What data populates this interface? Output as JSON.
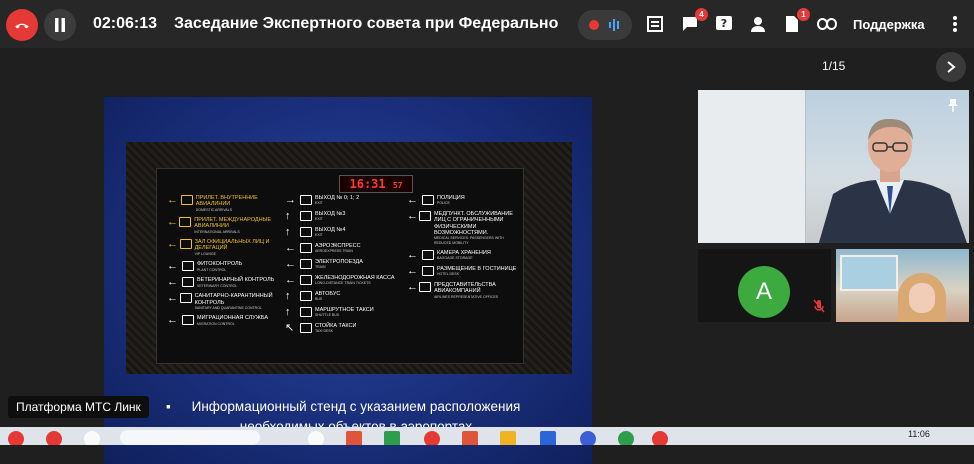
{
  "header": {
    "timer": "02:06:13",
    "title": "Заседание Экспертного совета при Федеральном р",
    "support_label": "Поддержка",
    "chat_badge": "4",
    "docs_badge": "1"
  },
  "presentation": {
    "page_counter": "1/15",
    "clock": "16:31",
    "clock_seconds": "57",
    "caption": "Информационный стенд с указанием расположения необходимых объектов в аэропортах",
    "signs_left": [
      {
        "text": "ПРИЛЕТ. ВНУТРЕННИЕ АВИАЛИНИИ",
        "sub": "DOMESTIC ARRIVALS",
        "arrow": "←"
      },
      {
        "text": "ПРИЛЕТ. МЕЖДУНАРОДНЫЕ АВИАЛИНИИ",
        "sub": "INTERNATIONAL ARRIVALS",
        "arrow": "←"
      },
      {
        "text": "ЗАЛ ОФИЦИАЛЬНЫХ ЛИЦ И ДЕЛЕГАЦИЙ",
        "sub": "VIP LOUNGE",
        "arrow": "←"
      },
      {
        "text": "ФИТОКОНТРОЛЬ",
        "sub": "PLANT CONTROL",
        "arrow": "←"
      },
      {
        "text": "ВЕТЕРИНАРНЫЙ КОНТРОЛЬ",
        "sub": "VETERINARY CONTROL",
        "arrow": "←"
      },
      {
        "text": "САНИТАРНО-КАРАНТИННЫЙ КОНТРОЛЬ",
        "sub": "SANITARY AND QUARANTINE CONTROL",
        "arrow": "←"
      },
      {
        "text": "МИГРАЦИОННАЯ СЛУЖБА",
        "sub": "MIGRATION CONTROL",
        "arrow": "←"
      }
    ],
    "signs_mid": [
      {
        "text": "ВЫХОД № 0; 1; 2",
        "sub": "EXIT",
        "arrow": "→"
      },
      {
        "text": "ВЫХОД №3",
        "sub": "EXIT",
        "arrow": "↑"
      },
      {
        "text": "ВЫХОД №4",
        "sub": "EXIT",
        "arrow": "↑"
      },
      {
        "text": "АЭРОЭКСПРЕСС",
        "sub": "AEROEXPRESS TRAIN",
        "arrow": "←"
      },
      {
        "text": "ЭЛЕКТРОПОЕЗДА",
        "sub": "TRAIN",
        "arrow": "←"
      },
      {
        "text": "ЖЕЛЕЗНОДОРОЖНАЯ КАССА",
        "sub": "LONG-DISTANCE TRAIN TICKETS",
        "arrow": "←"
      },
      {
        "text": "АВТОБУС",
        "sub": "BUS",
        "arrow": "↑"
      },
      {
        "text": "МАРШРУТНОЕ ТАКСИ",
        "sub": "SHUTTLE BUS",
        "arrow": "↑"
      },
      {
        "text": "СТОЙКА ТАКСИ",
        "sub": "TAXI DESK",
        "arrow": "↖"
      }
    ],
    "signs_right": [
      {
        "text": "ПОЛИЦИЯ",
        "sub": "POLICE",
        "arrow": "←"
      },
      {
        "text": "МЕДПУНКТ. ОБСЛУЖИВАНИЕ ЛИЦ С ОГРАНИЧЕННЫМИ ФИЗИЧЕСКИМИ ВОЗМОЖНОСТЯМИ.",
        "sub": "MEDICAL SERVICES. PASSENGERS WITH REDUCED MOBILITY",
        "arrow": "←"
      },
      {
        "text": "КАМЕРА ХРАНЕНИЯ",
        "sub": "BAGGAGE STORAGE",
        "arrow": "←"
      },
      {
        "text": "РАЗМЕЩЕНИЕ В ГОСТИНИЦЕ",
        "sub": "HOTEL DESK",
        "arrow": "←"
      },
      {
        "text": "ПРЕДСТАВИТЕЛЬСТВА АВИАКОМПАНИЙ",
        "sub": "AIRLINES REPRESENTATIVE OFFICES",
        "arrow": "←"
      }
    ]
  },
  "participants": {
    "avatar_letter": "A"
  },
  "tooltip": "Платформа МТС Линк",
  "taskbar": {
    "time": "11:06"
  },
  "colors": {
    "accent_red": "#e53935",
    "avatar_green": "#3daa3f",
    "sign_yellow": "#f2c11a"
  }
}
